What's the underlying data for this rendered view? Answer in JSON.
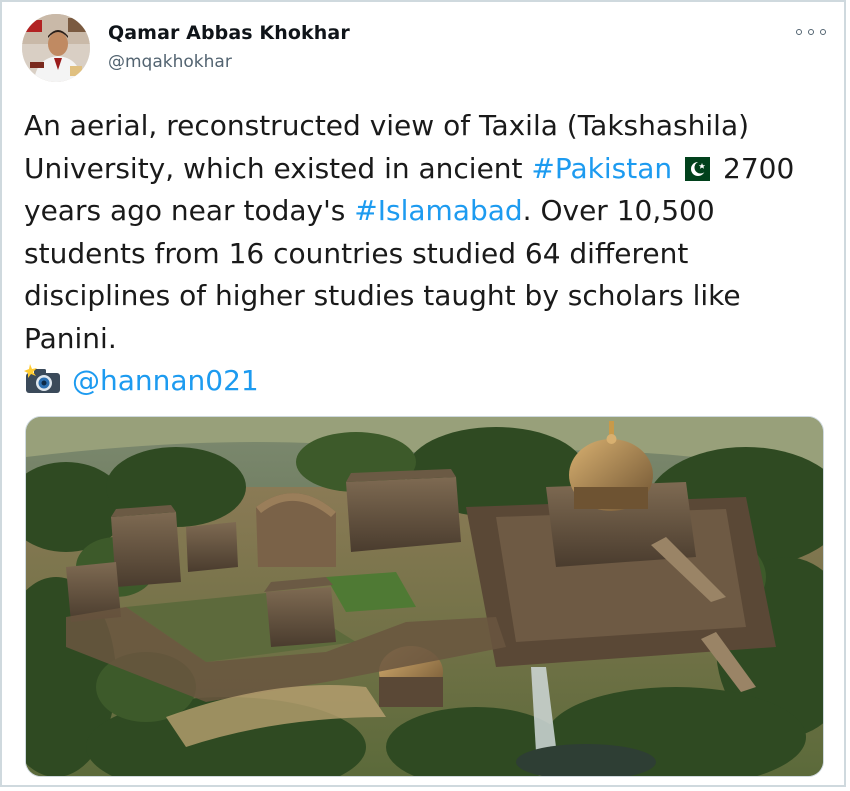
{
  "tweet": {
    "author_name": "Qamar Abbas Khokhar",
    "author_handle": "@mqakhokhar",
    "more_icon": "more-dots-icon",
    "text_lines": [
      [
        "An aerial, reconstructed view of Taxila (Takshashila)"
      ],
      [
        "University, which existed in ancient "
      ],
      [
        " 2700"
      ],
      [
        "years ago near today's "
      ],
      [
        ". Over 10,500"
      ],
      [
        "students from 16 countries studied 64 different"
      ],
      [
        "disciplines of higher studies taught by scholars like"
      ],
      [
        "Panini."
      ]
    ],
    "hashtag_pakistan": "#Pakistan",
    "hashtag_islamabad": "#Islamabad",
    "flag_icon": "pakistan-flag-icon",
    "camera_icon": "camera-flash-icon",
    "mention": "@hannan021",
    "image_description": "Aerial reconstruction of Taxila university complex",
    "colors": {
      "link": "#1d9bf0",
      "secondary_text": "#536471",
      "border": "#cfd9de"
    }
  }
}
